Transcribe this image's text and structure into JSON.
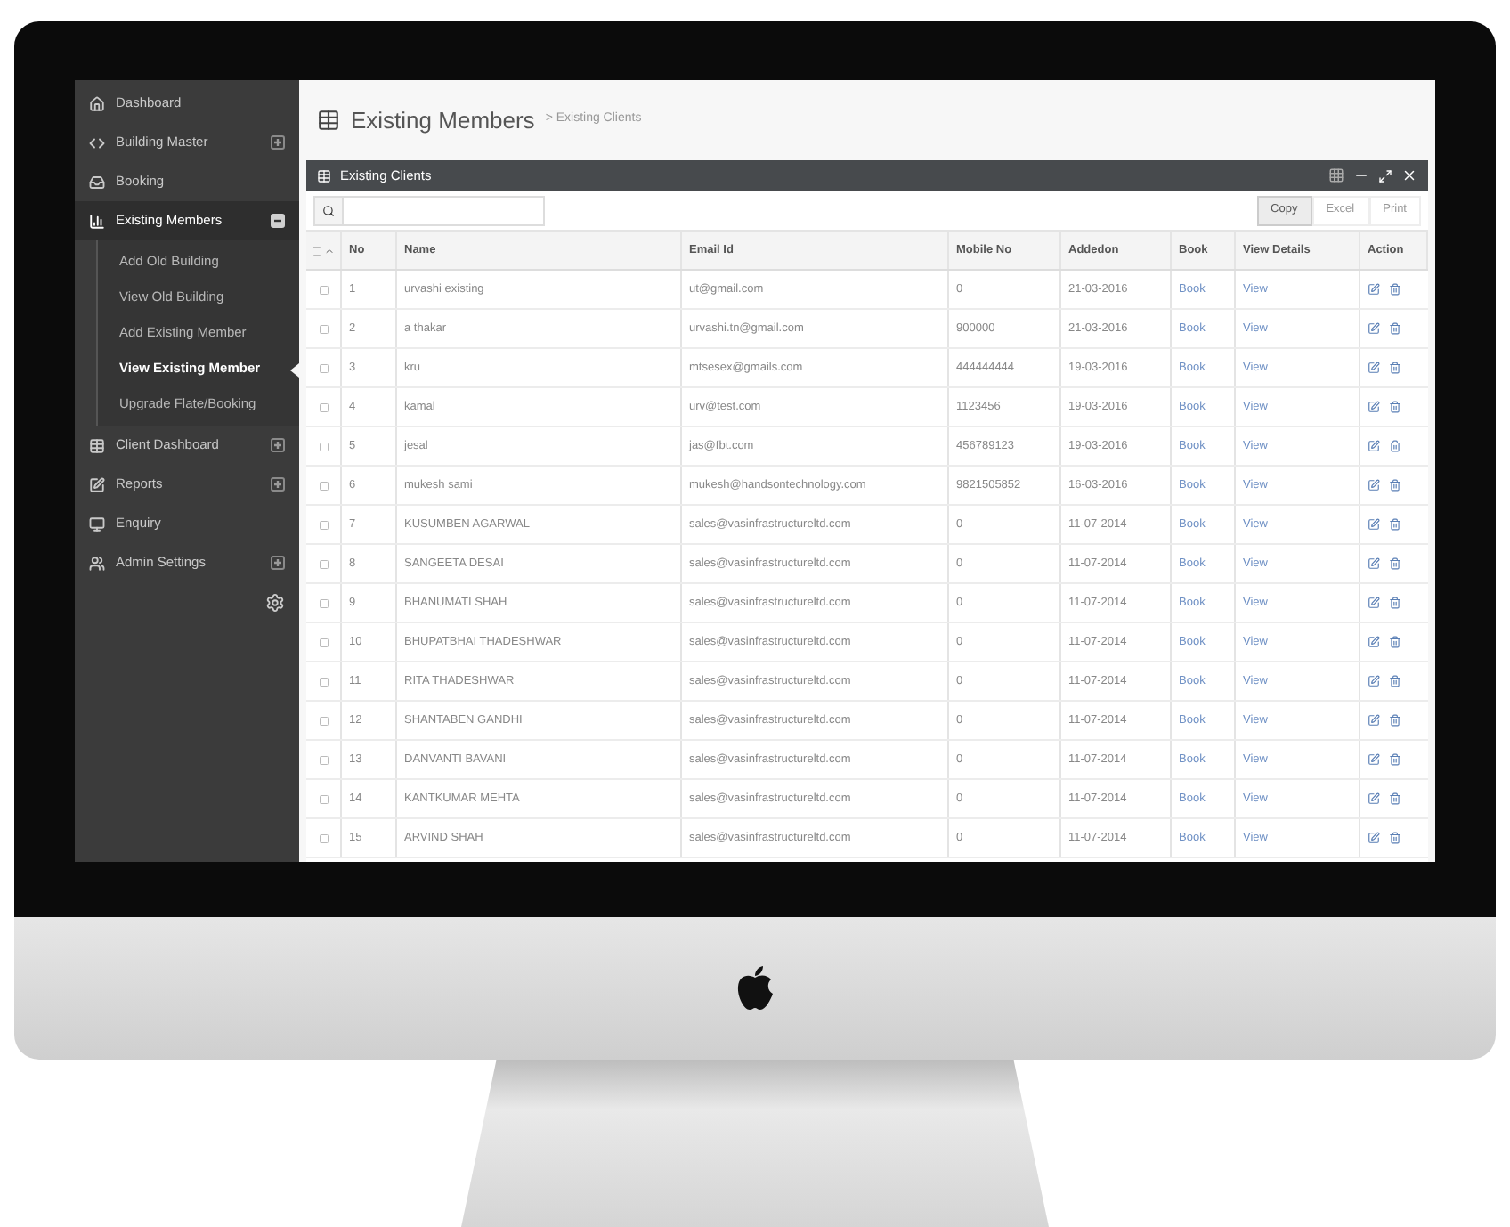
{
  "sidebar": {
    "items": [
      {
        "label": "Dashboard",
        "selected": false
      },
      {
        "label": "Building Master",
        "expanded": false,
        "selected": false
      },
      {
        "label": "Booking",
        "selected": false
      },
      {
        "label": "Existing Members",
        "expanded": true,
        "selected": true,
        "children": [
          {
            "label": "Add Old Building",
            "selected": false
          },
          {
            "label": "View Old Building",
            "selected": false
          },
          {
            "label": "Add Existing Member",
            "selected": false
          },
          {
            "label": "View Existing Member",
            "selected": true
          },
          {
            "label": "Upgrade Flate/Booking",
            "selected": false
          }
        ]
      },
      {
        "label": "Client Dashboard",
        "expanded": false,
        "selected": false
      },
      {
        "label": "Reports",
        "expanded": false,
        "selected": false
      },
      {
        "label": "Enquiry",
        "selected": false
      },
      {
        "label": "Admin Settings",
        "expanded": false,
        "selected": false
      }
    ]
  },
  "page": {
    "title": "Existing Members",
    "breadcrumb": "> Existing Clients"
  },
  "panel": {
    "title": "Existing Clients",
    "buttons": [
      {
        "label": "Copy",
        "selected": true
      },
      {
        "label": "Excel",
        "selected": false
      },
      {
        "label": "Print",
        "selected": false
      }
    ]
  },
  "table": {
    "select_all_checked": false,
    "columns": [
      "No",
      "Name",
      "Email Id",
      "Mobile No",
      "Addedon",
      "Book",
      "View Details",
      "Action"
    ],
    "rows": [
      {
        "checked": false,
        "no": "1",
        "name": "urvashi existing",
        "email": "ut@gmail.com",
        "mobile": "0",
        "added": "21-03-2016",
        "book": "Book",
        "view": "View"
      },
      {
        "checked": false,
        "no": "2",
        "name": "a thakar",
        "email": "urvashi.tn@gmail.com",
        "mobile": "900000",
        "added": "21-03-2016",
        "book": "Book",
        "view": "View"
      },
      {
        "checked": false,
        "no": "3",
        "name": "kru",
        "email": "mtsesex@gmails.com",
        "mobile": "444444444",
        "added": "19-03-2016",
        "book": "Book",
        "view": "View"
      },
      {
        "checked": false,
        "no": "4",
        "name": "kamal",
        "email": "urv@test.com",
        "mobile": "1123456",
        "added": "19-03-2016",
        "book": "Book",
        "view": "View"
      },
      {
        "checked": false,
        "no": "5",
        "name": "jesal",
        "email": "jas@fbt.com",
        "mobile": "456789123",
        "added": "19-03-2016",
        "book": "Book",
        "view": "View"
      },
      {
        "checked": false,
        "no": "6",
        "name": "mukesh sami",
        "email": "mukesh@handsontechnology.com",
        "mobile": "9821505852",
        "added": "16-03-2016",
        "book": "Book",
        "view": "View"
      },
      {
        "checked": false,
        "no": "7",
        "name": "KUSUMBEN AGARWAL",
        "email": "sales@vasinfrastructureltd.com",
        "mobile": "0",
        "added": "11-07-2014",
        "book": "Book",
        "view": "View"
      },
      {
        "checked": false,
        "no": "8",
        "name": "SANGEETA DESAI",
        "email": "sales@vasinfrastructureltd.com",
        "mobile": "0",
        "added": "11-07-2014",
        "book": "Book",
        "view": "View"
      },
      {
        "checked": false,
        "no": "9",
        "name": "BHANUMATI SHAH",
        "email": "sales@vasinfrastructureltd.com",
        "mobile": "0",
        "added": "11-07-2014",
        "book": "Book",
        "view": "View"
      },
      {
        "checked": false,
        "no": "10",
        "name": "BHUPATBHAI THADESHWAR",
        "email": "sales@vasinfrastructureltd.com",
        "mobile": "0",
        "added": "11-07-2014",
        "book": "Book",
        "view": "View"
      },
      {
        "checked": false,
        "no": "11",
        "name": "RITA THADESHWAR",
        "email": "sales@vasinfrastructureltd.com",
        "mobile": "0",
        "added": "11-07-2014",
        "book": "Book",
        "view": "View"
      },
      {
        "checked": false,
        "no": "12",
        "name": "SHANTABEN GANDHI",
        "email": "sales@vasinfrastructureltd.com",
        "mobile": "0",
        "added": "11-07-2014",
        "book": "Book",
        "view": "View"
      },
      {
        "checked": false,
        "no": "13",
        "name": "DANVANTI BAVANI",
        "email": "sales@vasinfrastructureltd.com",
        "mobile": "0",
        "added": "11-07-2014",
        "book": "Book",
        "view": "View"
      },
      {
        "checked": false,
        "no": "14",
        "name": "KANTKUMAR MEHTA",
        "email": "sales@vasinfrastructureltd.com",
        "mobile": "0",
        "added": "11-07-2014",
        "book": "Book",
        "view": "View"
      },
      {
        "checked": false,
        "no": "15",
        "name": "ARVIND SHAH",
        "email": "sales@vasinfrastructureltd.com",
        "mobile": "0",
        "added": "11-07-2014",
        "book": "Book",
        "view": "View"
      }
    ]
  }
}
